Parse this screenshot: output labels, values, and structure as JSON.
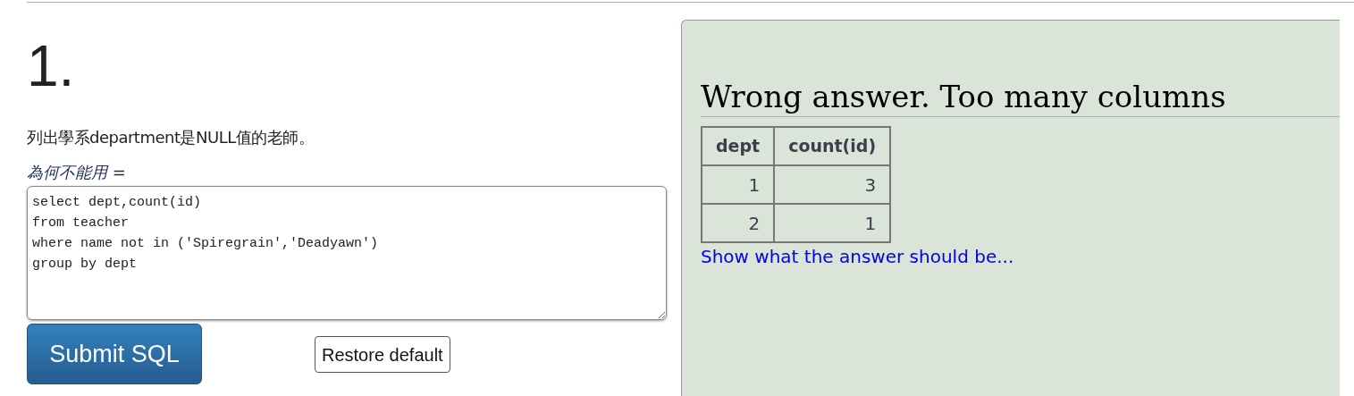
{
  "question": {
    "number": "1.",
    "text": "列出學系department是NULL值的老師。",
    "hint": "為何不能用 ="
  },
  "sql_editor": {
    "value": "select dept,count(id)\nfrom teacher\nwhere name not in ('Spiregrain','Deadyawn')\ngroup by dept"
  },
  "buttons": {
    "submit": "Submit SQL",
    "restore": "Restore default"
  },
  "result": {
    "message": "Wrong answer. Too many columns",
    "table": {
      "columns": [
        "dept",
        "count(id)"
      ],
      "rows": [
        [
          "1",
          "3"
        ],
        [
          "2",
          "1"
        ]
      ]
    },
    "show_answer_link": "Show what the answer should be..."
  }
}
